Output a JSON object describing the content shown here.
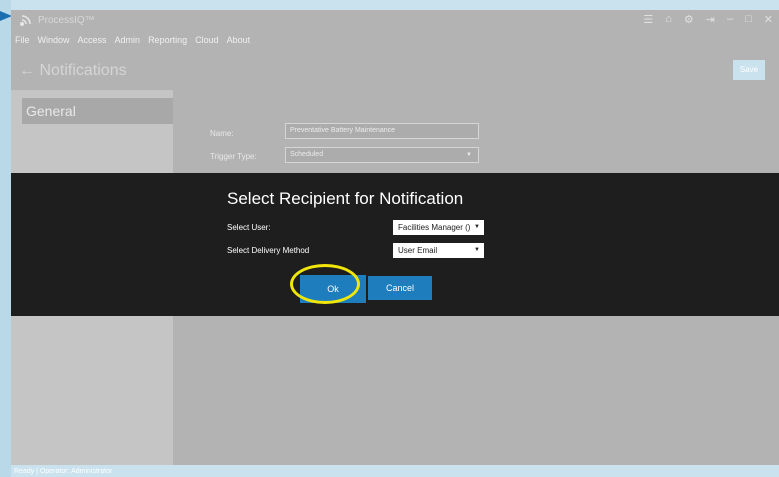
{
  "app": {
    "title": "ProcessIQ™"
  },
  "menu": [
    "File",
    "Window",
    "Access",
    "Admin",
    "Reporting",
    "Cloud",
    "About"
  ],
  "titlebar_icons": [
    "menu-icon",
    "home-icon",
    "gear-icon",
    "logout-icon",
    "minimize-icon",
    "maximize-icon",
    "close-icon"
  ],
  "page": {
    "title": "← Notifications",
    "save_label": "Save"
  },
  "sidebar": {
    "items": [
      {
        "label": "General"
      }
    ]
  },
  "form": {
    "name_label": "Name:",
    "name_value": "Preventative Battery Maintenance",
    "trigger_label": "Trigger Type:",
    "trigger_value": "Scheduled"
  },
  "modal": {
    "title": "Select Recipient for Notification",
    "user_label": "Select User:",
    "user_value": "Facilities Manager ()",
    "delivery_label": "Select Delivery Method",
    "delivery_value": "User Email",
    "ok_label": "Ok",
    "cancel_label": "Cancel"
  },
  "status": {
    "text": "Ready  |  Operator:  Administrator"
  },
  "colors": {
    "accent": "#1d7dbd",
    "highlight": "#f0e60a",
    "overlay": "#1e1e1e"
  }
}
